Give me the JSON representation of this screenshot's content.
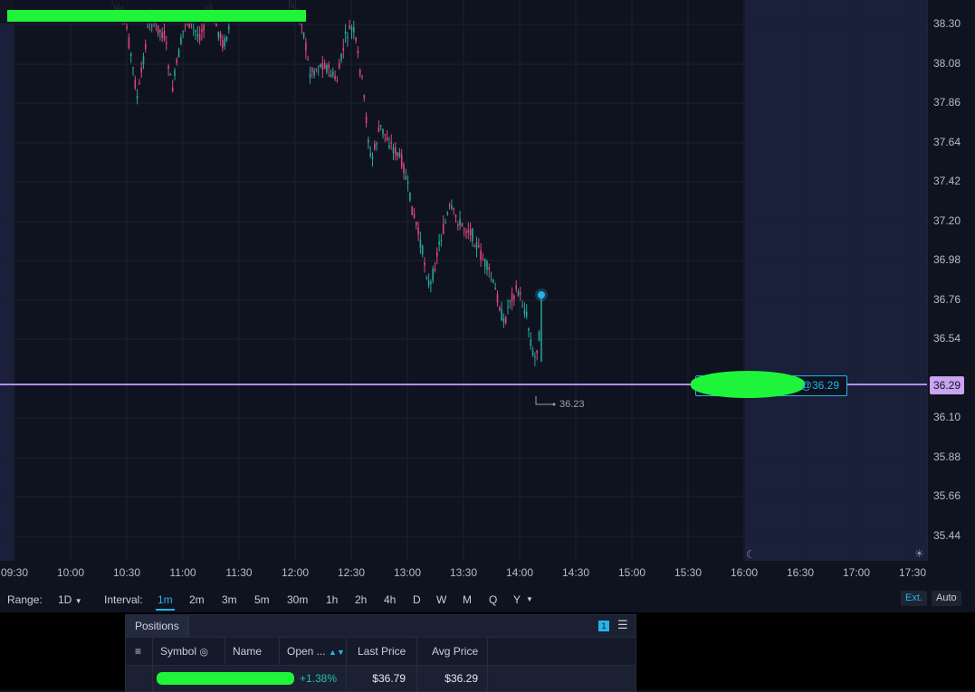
{
  "chart": {
    "y_ticks": [
      "38.30",
      "38.08",
      "37.86",
      "37.64",
      "37.42",
      "37.20",
      "36.98",
      "36.76",
      "36.54",
      "36.10",
      "35.88",
      "35.66",
      "35.44"
    ],
    "x_ticks": [
      "09:30",
      "10:00",
      "10:30",
      "11:00",
      "11:30",
      "12:00",
      "12:30",
      "13:00",
      "13:30",
      "14:00",
      "14:30",
      "15:00",
      "15:30",
      "16:00",
      "16:30",
      "17:00",
      "17:30"
    ],
    "current_price": "36.29",
    "order_label": "@36.29",
    "low_label": "36.23",
    "colors": {
      "up": "#26a69a",
      "down": "#e0457b",
      "price_line": "#b58cf0",
      "accent": "#25b3e8"
    },
    "icons": {
      "after_hours": "moon-icon",
      "premarket": "sun-icon"
    }
  },
  "toolbar": {
    "range_label": "Range:",
    "range_value": "1D",
    "interval_label": "Interval:",
    "intervals": [
      "1m",
      "2m",
      "3m",
      "5m",
      "30m",
      "1h",
      "2h",
      "4h",
      "D",
      "W",
      "M",
      "Q",
      "Y"
    ],
    "active_interval": "1m",
    "ext_button": "Ext.",
    "auto_button": "Auto"
  },
  "positions": {
    "tab_title": "Positions",
    "count": "1",
    "columns": [
      "Symbol",
      "Name",
      "Open ...",
      "Last Price",
      "Avg Price"
    ],
    "row": {
      "open_pl": "+1.38%",
      "last_price": "$36.79",
      "avg_price": "$36.29"
    }
  }
}
